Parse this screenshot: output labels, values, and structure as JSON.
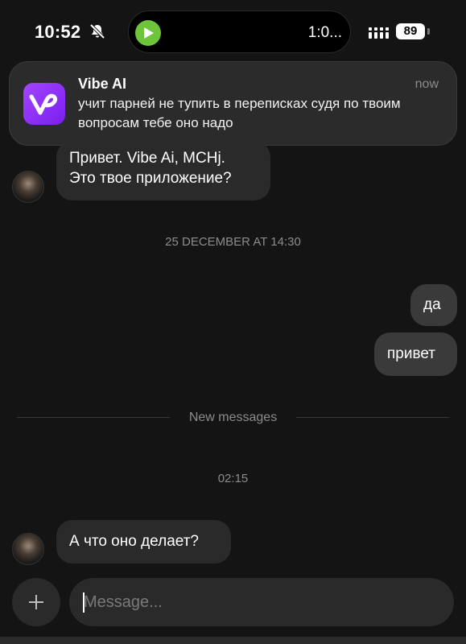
{
  "status_bar": {
    "time": "10:52",
    "live_activity_time": "1:0...",
    "battery": "89",
    "icons": [
      "bell-slash-icon",
      "play-icon",
      "cellular-signal-icon",
      "battery-icon"
    ]
  },
  "notification": {
    "app_name": "Vibe AI",
    "time": "now",
    "body": "учит парней не тупить в переписках судя по твоим вопросам тебе оно надо",
    "icon": "vibe-ai-logo-icon",
    "icon_color": "#9a3cff"
  },
  "messages": [
    {
      "direction": "incoming",
      "text_line1": "Привет. Vibe Ai, MCHj.",
      "text_line2": "Это твое приложение?"
    },
    {
      "direction": "outgoing",
      "text": "да"
    },
    {
      "direction": "outgoing",
      "text": "привет"
    },
    {
      "direction": "incoming",
      "text": "А что оно делает?"
    }
  ],
  "separators": {
    "date": "25 DECEMBER AT 14:30",
    "new_messages": "New messages",
    "time": "02:15"
  },
  "composer": {
    "placeholder": "Message...",
    "add_icon": "plus-icon"
  },
  "colors": {
    "background": "#141414",
    "incoming_bubble": "#2a2a2a",
    "outgoing_bubble": "#3a3a3a",
    "play_green": "#6fc53a"
  }
}
